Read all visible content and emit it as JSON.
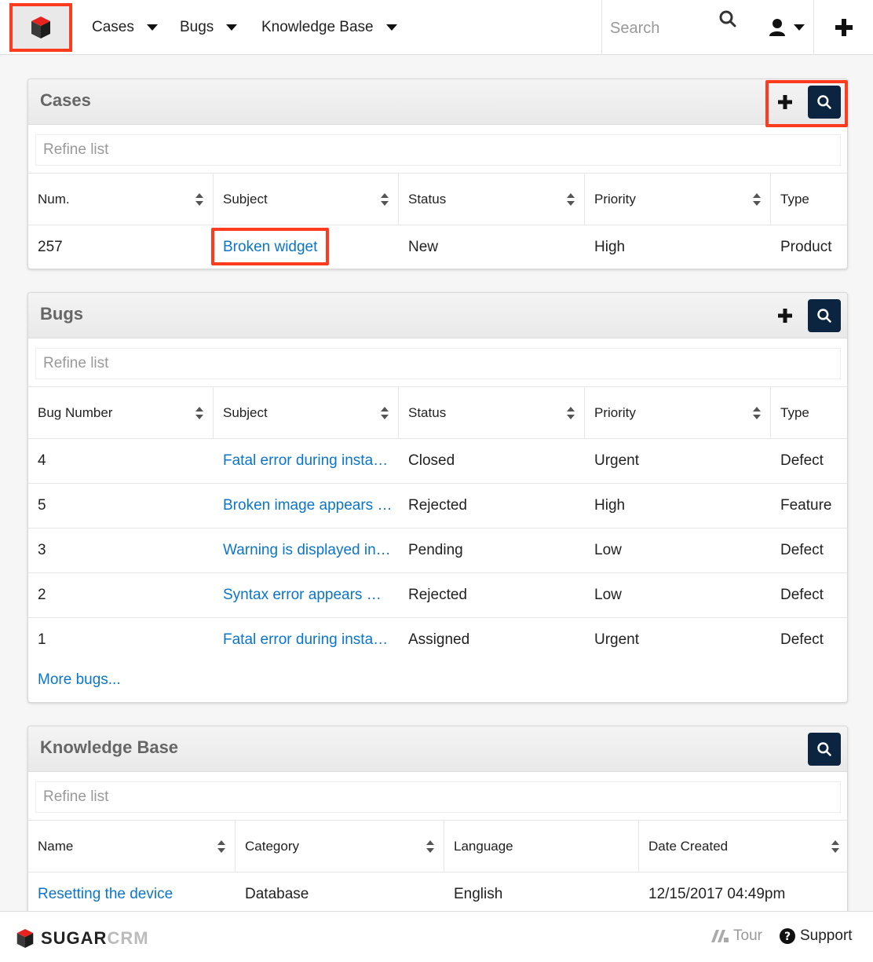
{
  "nav": {
    "items": [
      {
        "label": "Cases"
      },
      {
        "label": "Bugs"
      },
      {
        "label": "Knowledge Base"
      }
    ],
    "search_placeholder": "Search"
  },
  "colors": {
    "accent": "#0b75c9",
    "highlight": "#ff3b1f",
    "dark_button": "#0b2440"
  },
  "cases": {
    "title": "Cases",
    "refine_placeholder": "Refine list",
    "columns": [
      "Num.",
      "Subject",
      "Status",
      "Priority",
      "Type"
    ],
    "rows": [
      [
        "257",
        "Broken widget",
        "New",
        "High",
        "Product"
      ]
    ]
  },
  "bugs": {
    "title": "Bugs",
    "refine_placeholder": "Refine list",
    "columns": [
      "Bug Number",
      "Subject",
      "Status",
      "Priority",
      "Type"
    ],
    "rows": [
      [
        "4",
        "Fatal error during insta…",
        "Closed",
        "Urgent",
        "Defect"
      ],
      [
        "5",
        "Broken image appears …",
        "Rejected",
        "High",
        "Feature"
      ],
      [
        "3",
        "Warning is displayed in…",
        "Pending",
        "Low",
        "Defect"
      ],
      [
        "2",
        "Syntax error appears …",
        "Rejected",
        "Low",
        "Defect"
      ],
      [
        "1",
        "Fatal error during insta…",
        "Assigned",
        "Urgent",
        "Defect"
      ]
    ],
    "more_label": "More bugs..."
  },
  "kb": {
    "title": "Knowledge Base",
    "refine_placeholder": "Refine list",
    "columns": [
      "Name",
      "Category",
      "Language",
      "Date Created"
    ],
    "rows": [
      [
        "Resetting the device",
        "Database",
        "English",
        "12/15/2017 04:49pm"
      ]
    ]
  },
  "footer": {
    "brand_dark": "SUGAR",
    "brand_light": "CRM",
    "tour_label": "Tour",
    "support_label": "Support"
  }
}
